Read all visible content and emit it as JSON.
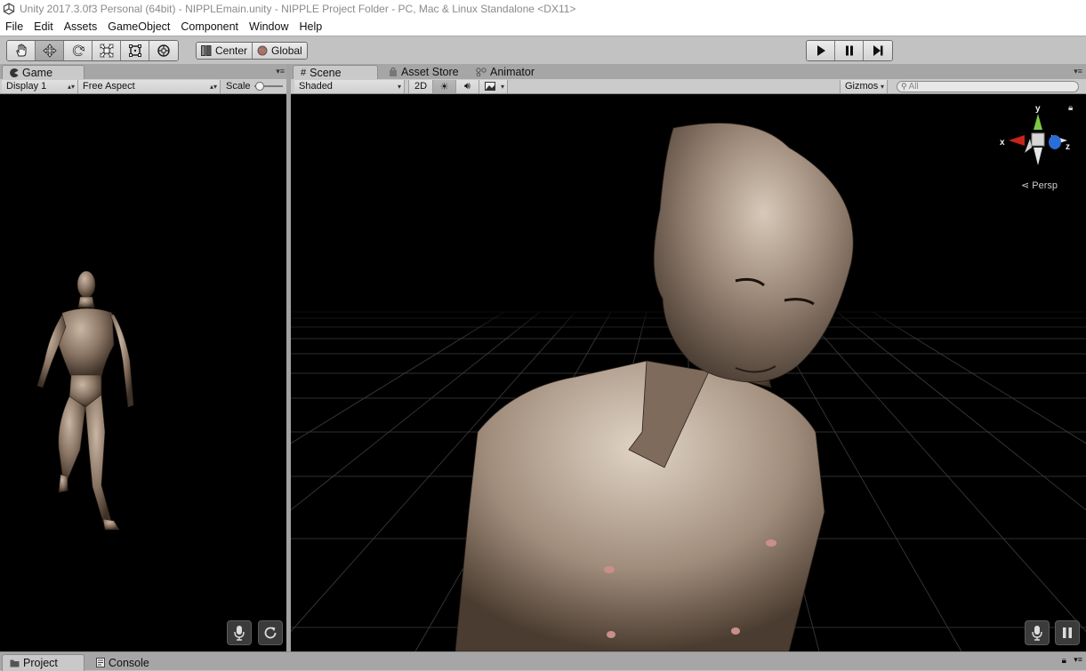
{
  "window": {
    "title": "Unity 2017.3.0f3 Personal (64bit) - NIPPLEmain.unity - NIPPLE Project Folder - PC, Mac & Linux Standalone <DX11>"
  },
  "menu": [
    "File",
    "Edit",
    "Assets",
    "GameObject",
    "Component",
    "Window",
    "Help"
  ],
  "toolbar": {
    "tools": [
      "hand-tool",
      "move-tool",
      "rotate-tool",
      "scale-tool",
      "rect-tool",
      "transform-tool"
    ],
    "pivot_label": "Center",
    "space_label": "Global"
  },
  "game": {
    "tab_label": "Game",
    "display": "Display 1",
    "aspect": "Free Aspect",
    "scale_label": "Scale",
    "scale_value": 0.05
  },
  "scene": {
    "tabs": [
      "Scene",
      "Asset Store",
      "Animator"
    ],
    "shading": "Shaded",
    "mode_2d": "2D",
    "gizmos_label": "Gizmos",
    "search_placeholder": "All",
    "gizmo_axes": {
      "x": "x",
      "y": "y",
      "z": "z"
    },
    "projection": "Persp"
  },
  "bottom": {
    "tabs": [
      "Project",
      "Console"
    ]
  },
  "colors": {
    "x_axis": "#c8231c",
    "y_axis": "#7ac943",
    "z_axis": "#2b6dd6",
    "viewport": "#000000"
  }
}
